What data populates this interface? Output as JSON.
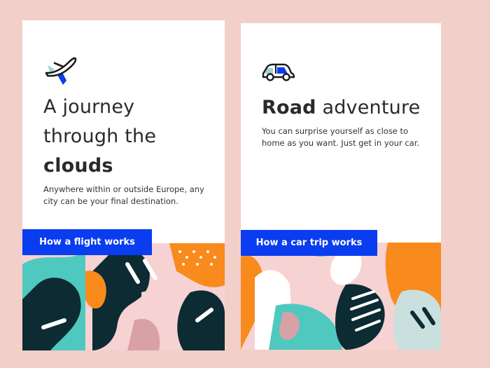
{
  "colors": {
    "background": "#f2cfc9",
    "cta": "#0a3cf0",
    "navy": "#0c2b33",
    "teal": "#4fc9c0",
    "orange": "#f98a1c",
    "pink": "#f7d2d3"
  },
  "cards": [
    {
      "icon": "airplane-icon",
      "title_line1": "A journey",
      "title_line2": "through the",
      "title_bold": "clouds",
      "description": "Anywhere within or outside Europe, any city can be your final destination.",
      "cta_label": "How a flight works"
    },
    {
      "icon": "car-icon",
      "title_bold": "Road",
      "title_rest": " adventure",
      "description": "You can surprise yourself as close to home as you want. Just get in your car.",
      "cta_label": "How a car trip works"
    }
  ]
}
